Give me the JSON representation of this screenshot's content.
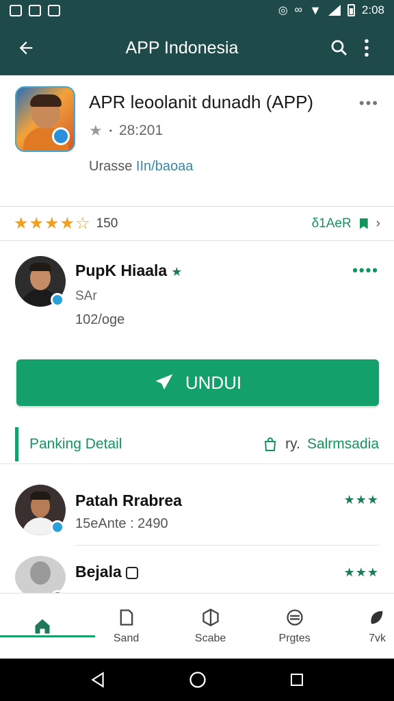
{
  "status_bar": {
    "left_icons": [
      "notification-icon",
      "notification-icon",
      "photo-icon"
    ],
    "time": "2:08"
  },
  "app_bar": {
    "title": "APP Indonesia"
  },
  "app_card": {
    "name": "APR leoolanit dunadh (APP)",
    "meta": "28:201",
    "category_key": "Urasse",
    "category_value": "IIn/baoaa"
  },
  "rating": {
    "stars_filled": 4,
    "stars_total": 5,
    "count": "150",
    "right_label": "δ1AeR"
  },
  "developer": {
    "name": "PupK Hiaala",
    "sub": "SAr",
    "size": "102/oge"
  },
  "install": {
    "label": "UNDUI"
  },
  "ranking": {
    "label": "Panking Detail",
    "right_prefix": "ry.",
    "right_value": "Salrmsadia"
  },
  "list": [
    {
      "name": "Patah Rrabrea",
      "sub": "15eAnte : 2490",
      "stars": "★★★"
    },
    {
      "name": "Bejala",
      "sub": "",
      "stars": "★★★"
    }
  ],
  "bottom_nav": [
    {
      "label": "",
      "icon": "home-icon"
    },
    {
      "label": "Sand",
      "icon": "doc-icon"
    },
    {
      "label": "Scabe",
      "icon": "cube-icon"
    },
    {
      "label": "Prgtes",
      "icon": "layers-icon"
    },
    {
      "label": "7vk",
      "icon": "leaf-icon"
    }
  ],
  "colors": {
    "app_bar": "#1f4a4a",
    "accent": "#14a06a",
    "star": "#f0a020"
  }
}
